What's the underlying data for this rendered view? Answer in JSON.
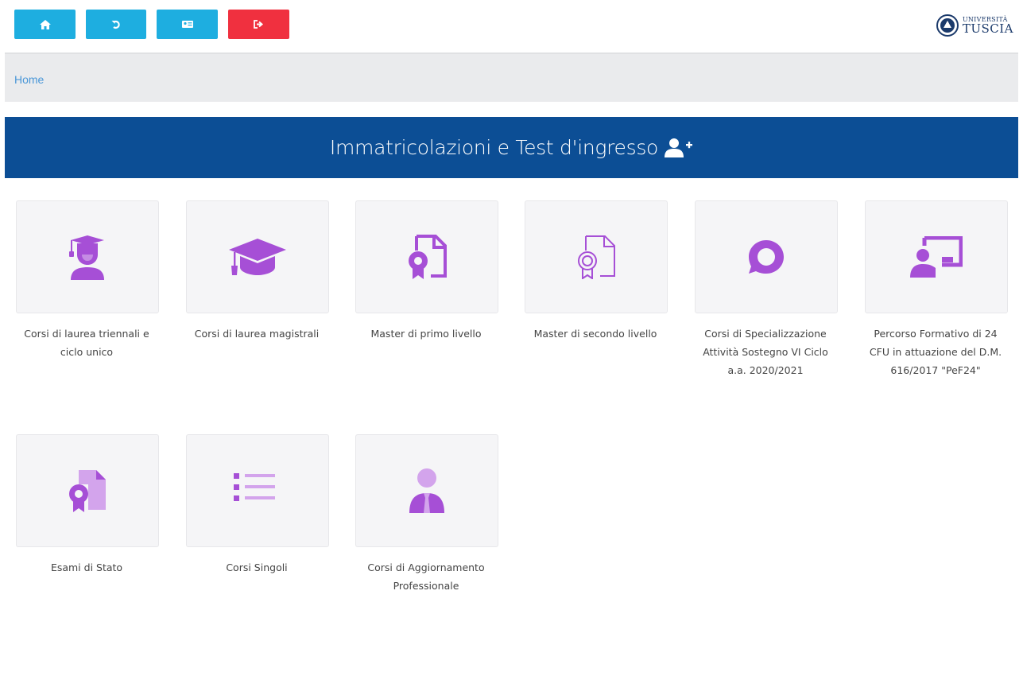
{
  "topbar": {
    "buttons": [
      {
        "name": "home",
        "icon": "home-icon",
        "color": "#1eaee0"
      },
      {
        "name": "back",
        "icon": "undo-icon",
        "color": "#1eaee0"
      },
      {
        "name": "card",
        "icon": "id-card-icon",
        "color": "#1eaee0"
      },
      {
        "name": "logout",
        "icon": "sign-out-icon",
        "color": "#f0303f"
      }
    ],
    "logo": {
      "line1": "UNIVERSITÀ",
      "line2": "TUSCIA"
    }
  },
  "breadcrumb": {
    "home": "Home"
  },
  "banner": {
    "title": "Immatricolazioni e Test d'ingresso",
    "icon": "user-plus-icon",
    "color": "#0c4e95"
  },
  "accent_color": "#a64fd6",
  "cards": [
    {
      "label": "Corsi di laurea triennali e ciclo unico",
      "icon": "graduate-student-icon"
    },
    {
      "label": "Corsi di laurea magistrali",
      "icon": "graduation-cap-icon"
    },
    {
      "label": "Master di primo livello",
      "icon": "certificate-icon"
    },
    {
      "label": "Master di secondo livello",
      "icon": "certificate-outline-icon"
    },
    {
      "label": "Corsi di Specializzazione Attività Sostegno VI Ciclo a.a. 2020/2021",
      "icon": "speech-bubble-icon"
    },
    {
      "label": "Percorso Formativo di 24 CFU in attuazione del D.M. 616/2017 \"PeF24\"",
      "icon": "teacher-board-icon"
    },
    {
      "label": "Esami di Stato",
      "icon": "award-document-icon"
    },
    {
      "label": "Corsi Singoli",
      "icon": "list-icon"
    },
    {
      "label": "Corsi di Aggiornamento Professionale",
      "icon": "professional-person-icon"
    }
  ]
}
